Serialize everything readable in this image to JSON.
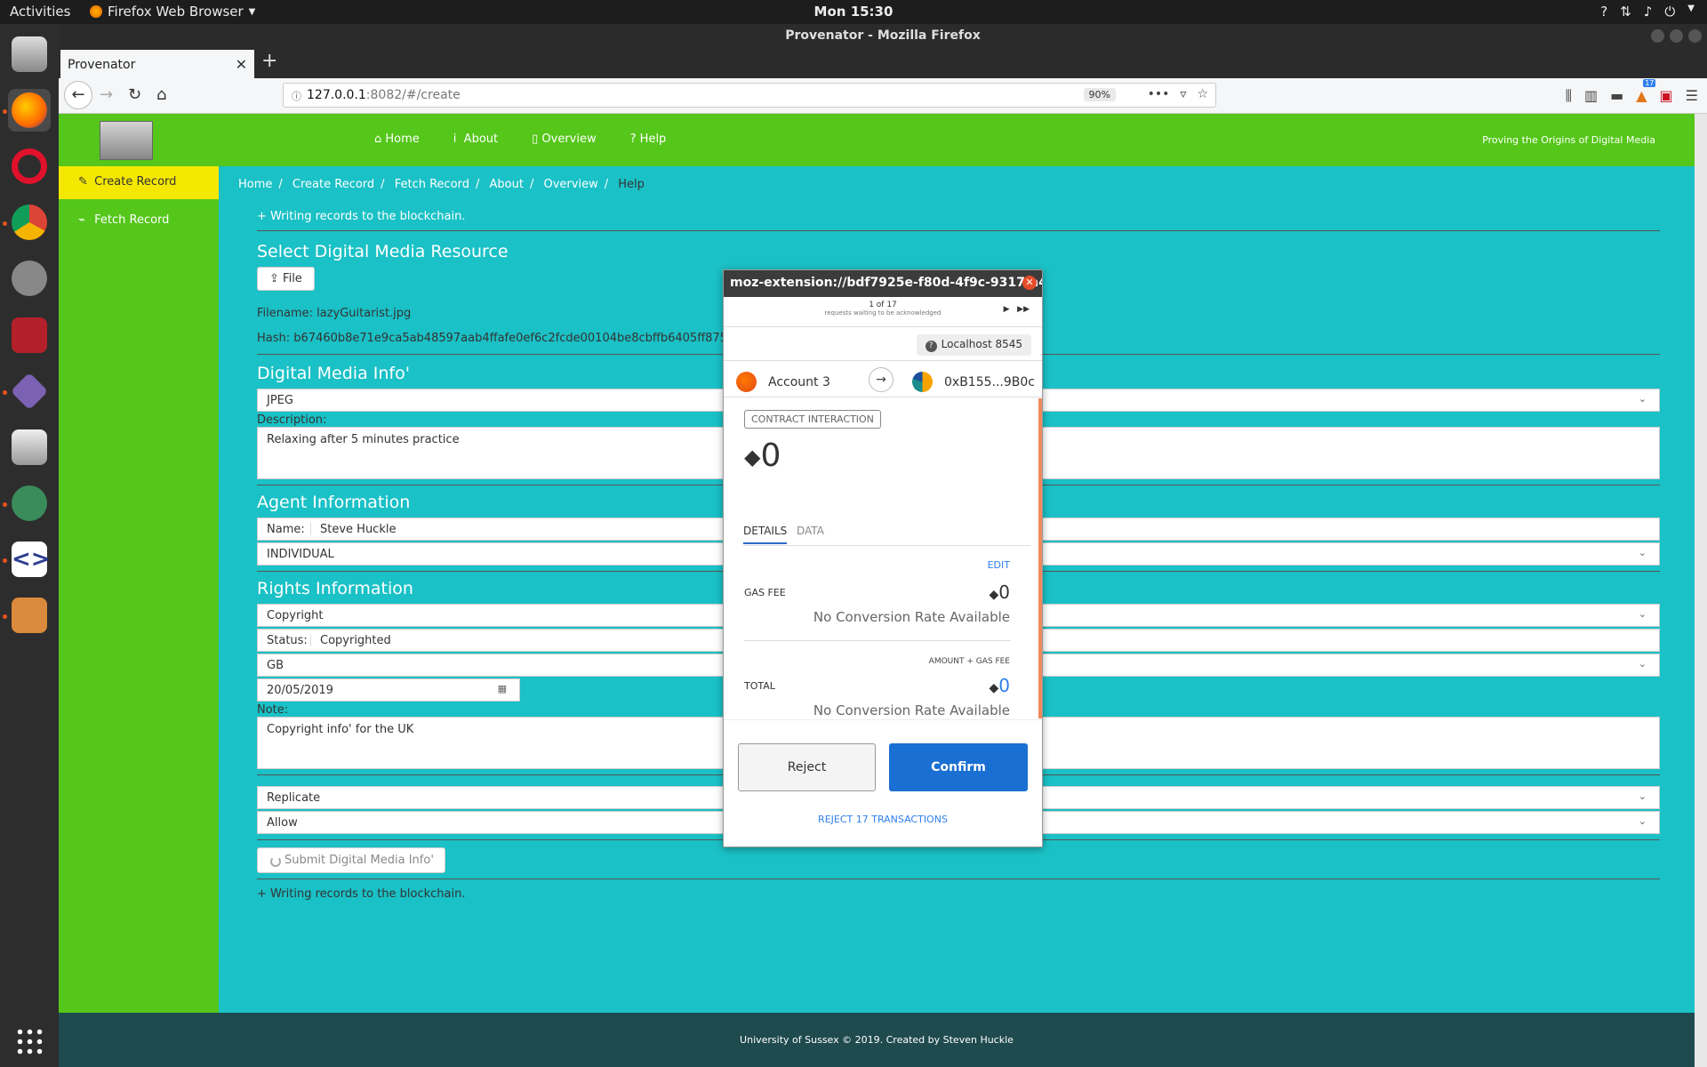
{
  "system": {
    "activities": "Activities",
    "app_name": "Firefox Web Browser",
    "clock": "Mon 15:30"
  },
  "browser": {
    "window_title": "Provenator - Mozilla Firefox",
    "tab_title": "Provenator",
    "url_host": "127.0.0.1",
    "url_rest": ":8082/#/create",
    "zoom": "90%",
    "badge_count": "17"
  },
  "site": {
    "tagline": "Proving the Origins of Digital Media",
    "nav": [
      "Home",
      "About",
      "Overview",
      "Help"
    ],
    "sidebar": [
      "Create Record",
      "Fetch Record"
    ],
    "breadcrumb": [
      "Home",
      "Create Record",
      "Fetch Record",
      "About",
      "Overview",
      "Help"
    ],
    "footer": "University of Sussex © 2019. Created by Steven Huckle"
  },
  "form": {
    "writing_note": "+ Writing records to the blockchain.",
    "select_title": "Select Digital Media Resource",
    "file_button": "File",
    "filename": "Filename: lazyGuitarist.jpg",
    "hash": "Hash: b67460b8e71e9ca5ab48597aab4ffafe0ef6c2fcde00104be8cbffb6405ff875",
    "media_info_title": "Digital Media Info'",
    "format": "JPEG",
    "description_label": "Description:",
    "description": "Relaxing after 5 minutes practice",
    "agent_title": "Agent Information",
    "name_label": "Name:",
    "name_value": "Steve Huckle",
    "agent_type": "INDIVIDUAL",
    "rights_title": "Rights Information",
    "rights_type": "Copyright",
    "status_label": "Status:",
    "status_value": "Copyrighted",
    "country": "GB",
    "date": "20/05/2019",
    "note_label": "Note:",
    "note": "Copyright info' for the UK",
    "replicate": "Replicate",
    "allow": "Allow",
    "submit": "Submit Digital Media Info'",
    "writing_note_bottom": "+ Writing records to the blockchain."
  },
  "metamask": {
    "title": "moz-extension://bdf7925e-f80d-4f9c-9317-a4...",
    "queue": "1 of 17",
    "queue_sub": "requests waiting to be acknowledged",
    "network": "Localhost 8545",
    "from_account": "Account 3",
    "to_address": "0xB155...9B0c",
    "type": "CONTRACT INTERACTION",
    "amount": "0",
    "tab_details": "DETAILS",
    "tab_data": "DATA",
    "edit": "EDIT",
    "gas_fee_label": "GAS FEE",
    "gas_fee_value": "0",
    "no_conversion": "No Conversion Rate Available",
    "amount_gas_label": "AMOUNT + GAS FEE",
    "total_label": "TOTAL",
    "total_value": "0",
    "reject": "Reject",
    "confirm": "Confirm",
    "reject_all": "REJECT 17 TRANSACTIONS"
  },
  "colors": {
    "green": "#55c61a",
    "teal": "#1ac1c6",
    "yellow": "#f5e800",
    "confirm_blue": "#1a6fd3"
  }
}
